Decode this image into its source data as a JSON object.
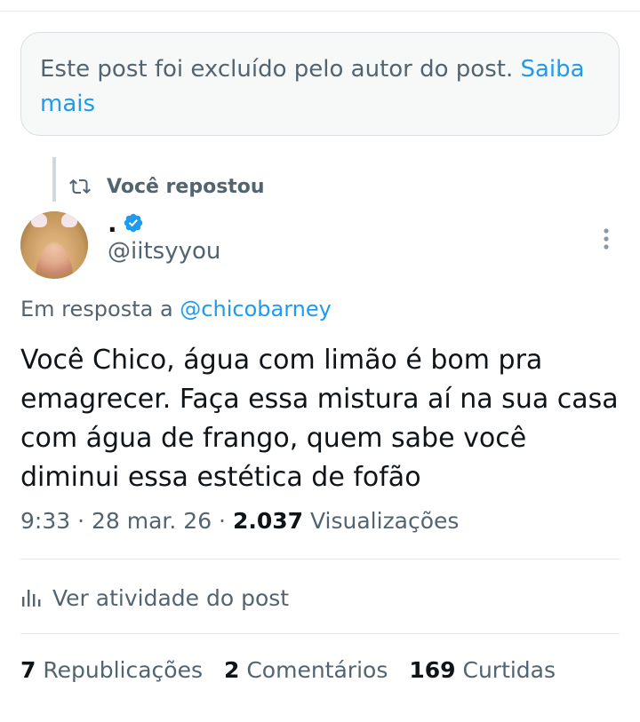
{
  "deleted_notice": {
    "text": "Este post foi excluído pelo autor do post.",
    "link": "Saiba mais"
  },
  "repost": {
    "label": "Você repostou",
    "icon": "repost-icon"
  },
  "author": {
    "display_name": ".",
    "handle": "@iitsyyou",
    "verified": true,
    "verified_color": "#1d9bf0"
  },
  "post": {
    "reply_prefix": "Em resposta a",
    "reply_mention": "@chicobarney",
    "text": "Você Chico, água com limão é bom pra emagrecer. Faça essa mistura aí na sua casa com água de frango, quem sabe você diminui essa estética de fofão",
    "time": "9:33",
    "date": "28 mar. 26",
    "views_count": "2.037",
    "views_label": "Visualizações"
  },
  "activity": {
    "label": "Ver atividade do post",
    "icon": "analytics-icon"
  },
  "stats": {
    "reposts_count": "7",
    "reposts_label": "Republicações",
    "comments_count": "2",
    "comments_label": "Comentários",
    "likes_count": "169",
    "likes_label": "Curtidas"
  },
  "colors": {
    "accent": "#1d9bf0",
    "secondary_text": "#536471",
    "primary_text": "#0f1419"
  }
}
